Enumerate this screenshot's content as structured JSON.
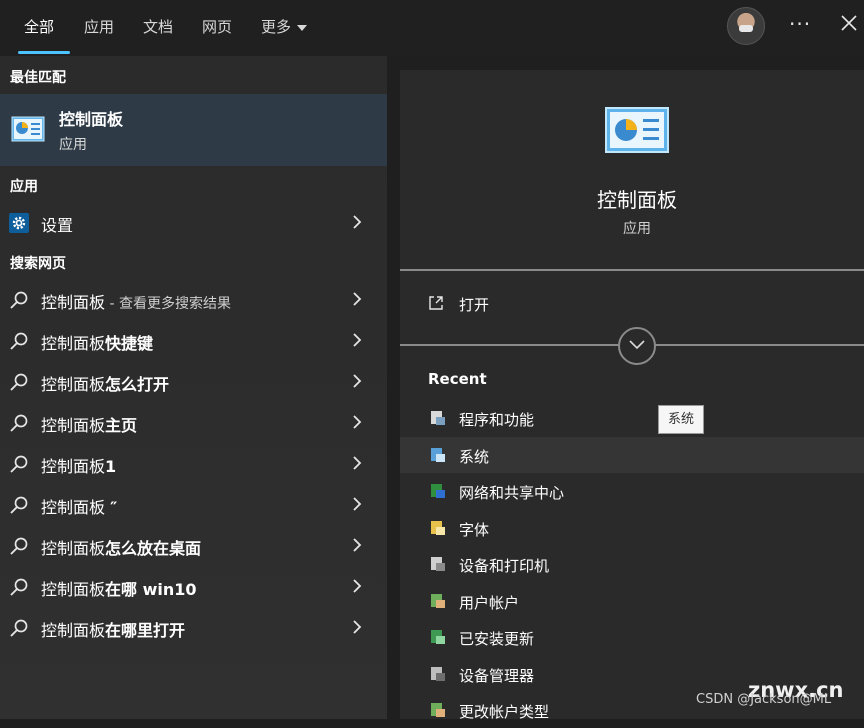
{
  "tabs": {
    "all": "全部",
    "apps": "应用",
    "docs": "文档",
    "web": "网页",
    "more": "更多"
  },
  "topbar": {
    "more_label": "···"
  },
  "left": {
    "best_match_title": "最佳匹配",
    "best_match": {
      "name": "控制面板",
      "type": "应用",
      "icon": "control-panel-icon"
    },
    "apps_title": "应用",
    "settings": {
      "label": "设置",
      "icon": "gear-icon"
    },
    "web_title": "搜索网页",
    "web_results": [
      {
        "normal": "控制面板",
        "bold": "",
        "hint": " - 查看更多搜索结果"
      },
      {
        "normal": "控制面板",
        "bold": "快捷键",
        "hint": ""
      },
      {
        "normal": "控制面板",
        "bold": "怎么打开",
        "hint": ""
      },
      {
        "normal": "控制面板",
        "bold": "主页",
        "hint": ""
      },
      {
        "normal": "控制面板",
        "bold": "1",
        "hint": ""
      },
      {
        "normal": "控制面板 ",
        "bold": "″",
        "hint": ""
      },
      {
        "normal": "控制面板",
        "bold": "怎么放在桌面",
        "hint": ""
      },
      {
        "normal": "控制面板",
        "bold": "在哪 win10",
        "hint": ""
      },
      {
        "normal": "控制面板",
        "bold": "在哪里打开",
        "hint": ""
      }
    ]
  },
  "right": {
    "title": "控制面板",
    "subtitle": "应用",
    "open_label": "打开",
    "recent_title": "Recent",
    "recent": [
      {
        "label": "程序和功能",
        "icon": "programs-icon"
      },
      {
        "label": "系统",
        "icon": "system-icon"
      },
      {
        "label": "网络和共享中心",
        "icon": "network-icon"
      },
      {
        "label": "字体",
        "icon": "fonts-icon"
      },
      {
        "label": "设备和打印机",
        "icon": "printer-icon"
      },
      {
        "label": "用户帐户",
        "icon": "users-icon"
      },
      {
        "label": "已安装更新",
        "icon": "updates-icon"
      },
      {
        "label": "设备管理器",
        "icon": "device-manager-icon"
      },
      {
        "label": "更改帐户类型",
        "icon": "users-icon"
      }
    ],
    "tooltip": "系统"
  },
  "watermark": {
    "site": "znwx.cn",
    "credit": "CSDN @Jackson@ML"
  },
  "colors": {
    "accent": "#4cc2ff",
    "selected_bg": "#2e3b47"
  }
}
